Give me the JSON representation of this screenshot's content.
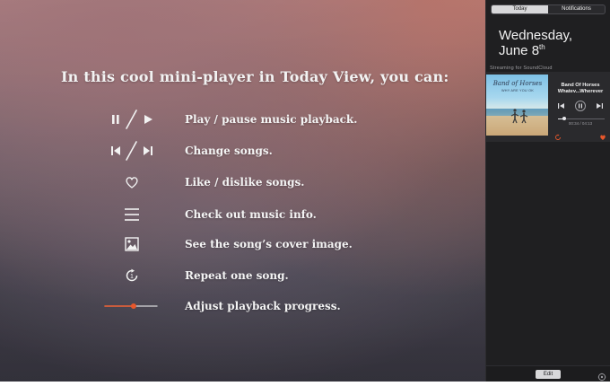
{
  "colors": {
    "accent_orange": "#e8572b",
    "text_light": "#f2f2f2",
    "panel_bg": "#1f1f21",
    "widget_bg": "#2a2a2d",
    "muted": "#9b9b9f"
  },
  "main": {
    "headline": "In this cool mini-player in Today View, you can:",
    "features": [
      {
        "icon": "play-pause-icon",
        "label": "Play / pause music playback."
      },
      {
        "icon": "previous-next-icon",
        "label": "Change songs."
      },
      {
        "icon": "heart-icon",
        "label": "Like / dislike songs."
      },
      {
        "icon": "menu-icon",
        "label": "Check out music info."
      },
      {
        "icon": "image-icon",
        "label": "See the song’s cover image."
      },
      {
        "icon": "repeat-one-icon",
        "label": "Repeat one song."
      },
      {
        "icon": "progress-bar-icon",
        "label": "Adjust playback progress."
      }
    ],
    "feature_progress_value": 0.55
  },
  "notification_center": {
    "tabs": [
      {
        "label": "Today",
        "active": true
      },
      {
        "label": "Notifications",
        "active": false
      }
    ],
    "date_line1": "Wednesday,",
    "date_line2": "June 8",
    "date_suffix": "th",
    "widget_title": "Streaming for SoundCloud",
    "player": {
      "cover_title": "Band of Horses",
      "cover_subtitle": "WHY ARE YOU OK",
      "artist": "Band Of Horses",
      "track": "Whatev...Wherever",
      "time": "00:34 / 04:13",
      "progress_fraction": 0.1344
    },
    "edit_label": "Edit"
  }
}
